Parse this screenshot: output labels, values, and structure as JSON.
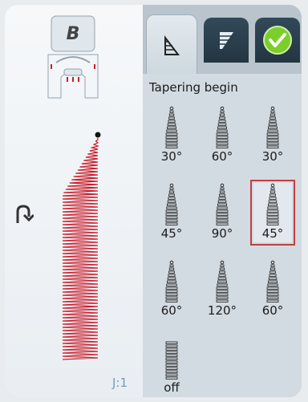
{
  "left_panel": {
    "foot": {
      "label": "B",
      "icon": "presser-foot-icon"
    },
    "needle_icon": "needle-rotate-icon",
    "stitch_preview": "tapered-zigzag-stitch",
    "j_label": "J:1"
  },
  "tabs": [
    {
      "icon": "taper-begin-icon",
      "active": true
    },
    {
      "icon": "taper-end-icon",
      "active": false
    },
    {
      "icon": "confirm-check-icon",
      "active": false
    }
  ],
  "panel": {
    "title": "Tapering begin",
    "options": [
      {
        "label": "30°"
      },
      {
        "label": "60°"
      },
      {
        "label": "30°"
      },
      {
        "label": "45°"
      },
      {
        "label": "90°"
      },
      {
        "label": "45°",
        "selected": true
      },
      {
        "label": "60°"
      },
      {
        "label": "120°"
      },
      {
        "label": "60°"
      },
      {
        "label": "off"
      }
    ]
  },
  "colors": {
    "stitch": "#c81e2c",
    "tab_dark": "#2a3d4a",
    "check_green": "#7ccf2a",
    "selection": "#c04040"
  }
}
